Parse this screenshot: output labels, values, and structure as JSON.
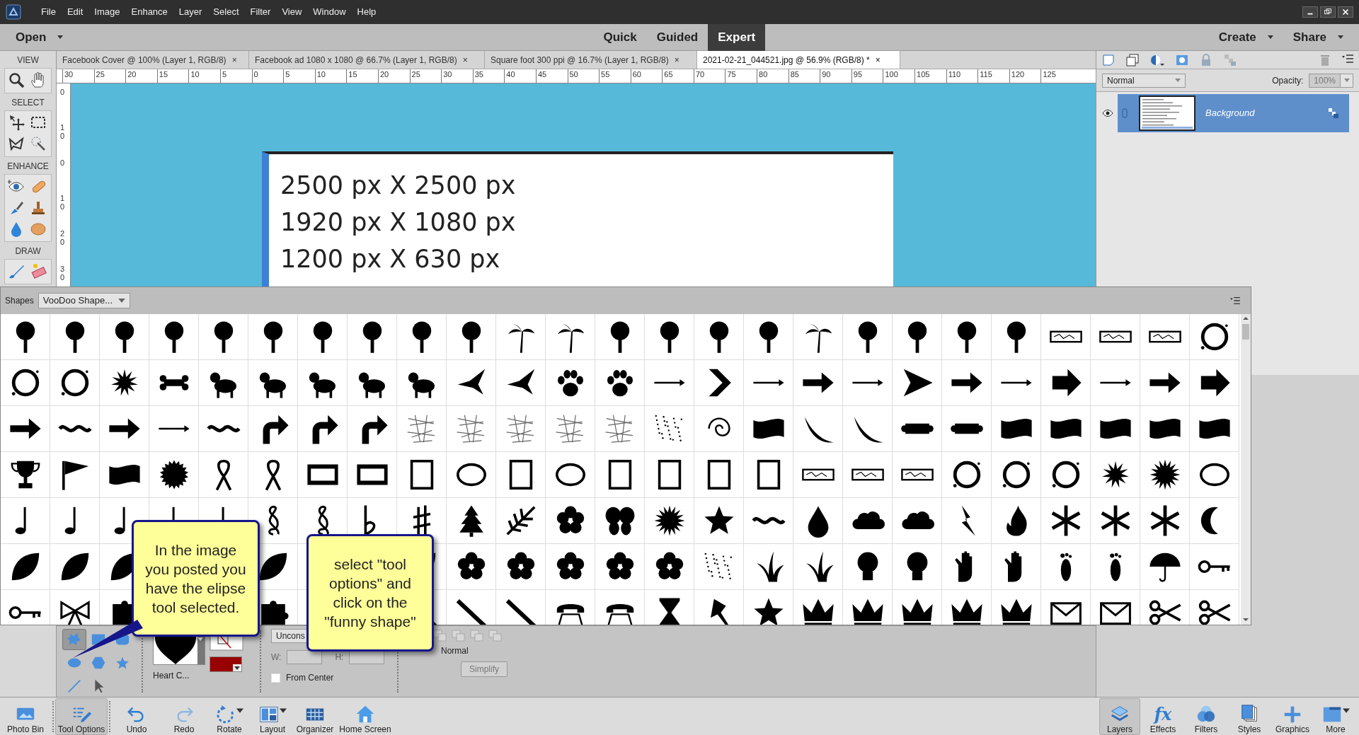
{
  "menu_bar": {
    "items": [
      "File",
      "Edit",
      "Image",
      "Enhance",
      "Layer",
      "Select",
      "Filter",
      "View",
      "Window",
      "Help"
    ]
  },
  "mode_bar": {
    "open": "Open",
    "modes": [
      {
        "label": "Quick",
        "selected": false
      },
      {
        "label": "Guided",
        "selected": false
      },
      {
        "label": "Expert",
        "selected": true
      }
    ],
    "actions": [
      "Create",
      "Share"
    ]
  },
  "toolbox": {
    "sections": [
      {
        "title": "VIEW",
        "tools": [
          {
            "kind": "zoom"
          },
          {
            "kind": "hand"
          }
        ]
      },
      {
        "title": "SELECT",
        "tools": [
          {
            "kind": "move"
          },
          {
            "kind": "marquee"
          },
          {
            "kind": "lasso"
          },
          {
            "kind": "wand"
          }
        ]
      },
      {
        "title": "ENHANCE",
        "tools": [
          {
            "kind": "eye"
          },
          {
            "kind": "bandage"
          },
          {
            "kind": "smartbrush"
          },
          {
            "kind": "stamp"
          },
          {
            "kind": "drop"
          },
          {
            "kind": "sponge"
          }
        ]
      },
      {
        "title": "DRAW",
        "tools": [
          {
            "kind": "brush"
          },
          {
            "kind": "eraser"
          }
        ]
      }
    ]
  },
  "document_tabs": [
    {
      "label": "Facebook Cover @ 100% (Layer 1, RGB/8)",
      "close": "×",
      "selected": false
    },
    {
      "label": "Facebook ad 1080 x 1080 @ 66.7% (Layer 1, RGB/8)",
      "close": "×",
      "selected": false
    },
    {
      "label": "Square foot 300 ppi @ 16.7% (Layer 1, RGB/8)",
      "close": "×",
      "selected": false
    },
    {
      "label": "2021-02-21_044521.jpg @ 56.9% (RGB/8) *",
      "close": "×",
      "selected": true
    }
  ],
  "rulers": {
    "horizontal": [
      "30",
      "25",
      "20",
      "15",
      "10",
      "5",
      "0",
      "5",
      "10",
      "15",
      "20",
      "25",
      "30",
      "35",
      "40",
      "45",
      "50",
      "55",
      "60",
      "65",
      "70",
      "75",
      "80",
      "85",
      "90",
      "95",
      "100",
      "105",
      "110",
      "115",
      "120",
      "125"
    ],
    "vertical": [
      "0",
      "10",
      "0",
      "10",
      "20",
      "30"
    ]
  },
  "document": {
    "lines": [
      "2500 px X 2500 px",
      "1920 px X 1080 px",
      "1200 px X 630 px"
    ]
  },
  "layers_panel": {
    "blend_mode": "Normal",
    "opacity_label": "Opacity:",
    "opacity": "100%",
    "layers": [
      {
        "name": "Background",
        "selected": true,
        "visible": true
      }
    ]
  },
  "shapes_panel": {
    "label": "Shapes",
    "library": "VooDoo Shape..."
  },
  "tool_options": {
    "shape_tools": [
      {
        "kind": "custom",
        "selected": true
      },
      {
        "kind": "rectangle",
        "selected": false
      },
      {
        "kind": "rounded",
        "selected": false
      },
      {
        "kind": "ellipse",
        "selected": false
      },
      {
        "kind": "polygon",
        "selected": false
      },
      {
        "kind": "star",
        "selected": false
      },
      {
        "kind": "line",
        "selected": false
      },
      {
        "kind": "selection",
        "selected": false
      }
    ],
    "shape_name": "Heart C...",
    "color": "#990000",
    "constraint": "Uncons",
    "width_label": "W:",
    "height_label": "H:",
    "from_center": {
      "label": "From Center",
      "checked": false
    },
    "mode": "Normal",
    "simplify": "Simplify"
  },
  "callouts": [
    {
      "text": "In the image you posted you have the elipse tool selected."
    },
    {
      "text": "select \"tool options\" and click on the \"funny shape\""
    }
  ],
  "taskbar": {
    "left": [
      {
        "kind": "photobin",
        "label": "Photo Bin",
        "selected": false,
        "has_menu": false
      },
      {
        "kind": "tooloptions",
        "label": "Tool Options",
        "selected": true,
        "has_menu": false
      },
      {
        "kind": "undo",
        "label": "Undo",
        "selected": false,
        "has_menu": false
      },
      {
        "kind": "redo",
        "label": "Redo",
        "selected": false,
        "has_menu": false
      },
      {
        "kind": "rotate",
        "label": "Rotate",
        "selected": false,
        "has_menu": true
      },
      {
        "kind": "layout",
        "label": "Layout",
        "selected": false,
        "has_menu": true
      },
      {
        "kind": "organizer",
        "label": "Organizer",
        "selected": false,
        "has_menu": false
      },
      {
        "kind": "home",
        "label": "Home Screen",
        "selected": false,
        "has_menu": false
      }
    ],
    "right": [
      {
        "kind": "layers",
        "label": "Layers",
        "selected": true,
        "has_menu": false
      },
      {
        "kind": "effects",
        "glyph": "fx",
        "label": "Effects",
        "selected": false,
        "has_menu": false
      },
      {
        "kind": "filters",
        "label": "Filters",
        "selected": false,
        "has_menu": false
      },
      {
        "kind": "styles",
        "label": "Styles",
        "selected": false,
        "has_menu": false
      },
      {
        "kind": "graphics",
        "label": "Graphics",
        "selected": false,
        "has_menu": false
      },
      {
        "kind": "more",
        "label": "More",
        "selected": false,
        "has_menu": true
      }
    ]
  }
}
